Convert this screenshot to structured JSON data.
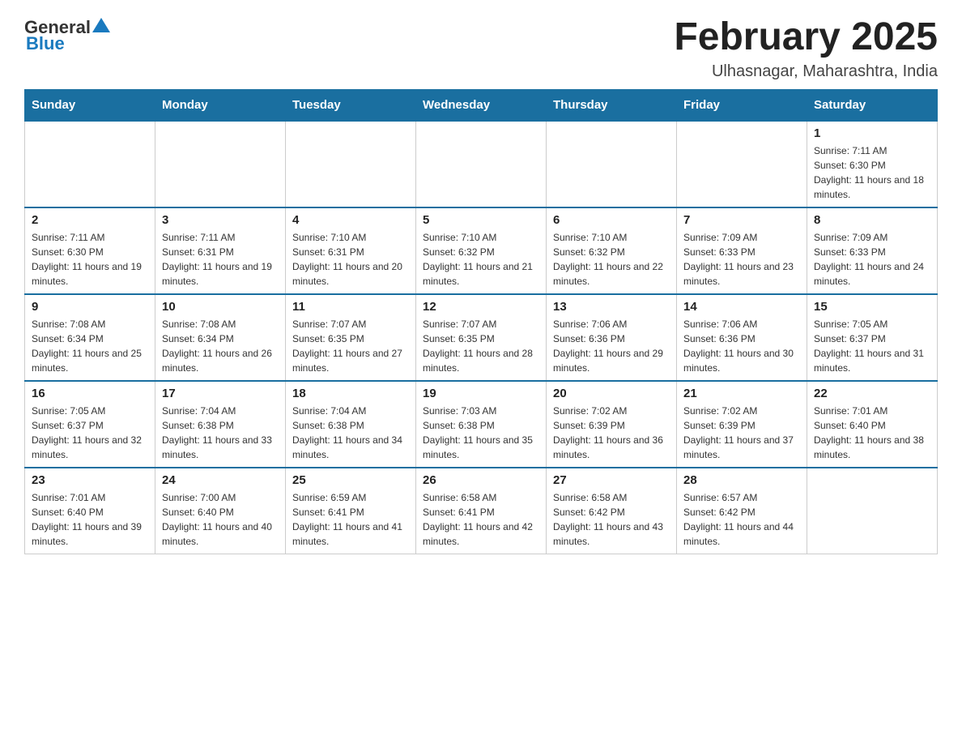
{
  "header": {
    "logo_general": "General",
    "logo_blue": "Blue",
    "month_title": "February 2025",
    "location": "Ulhasnagar, Maharashtra, India"
  },
  "weekdays": [
    "Sunday",
    "Monday",
    "Tuesday",
    "Wednesday",
    "Thursday",
    "Friday",
    "Saturday"
  ],
  "weeks": [
    [
      {
        "day": "",
        "sunrise": "",
        "sunset": "",
        "daylight": "",
        "empty": true
      },
      {
        "day": "",
        "sunrise": "",
        "sunset": "",
        "daylight": "",
        "empty": true
      },
      {
        "day": "",
        "sunrise": "",
        "sunset": "",
        "daylight": "",
        "empty": true
      },
      {
        "day": "",
        "sunrise": "",
        "sunset": "",
        "daylight": "",
        "empty": true
      },
      {
        "day": "",
        "sunrise": "",
        "sunset": "",
        "daylight": "",
        "empty": true
      },
      {
        "day": "",
        "sunrise": "",
        "sunset": "",
        "daylight": "",
        "empty": true
      },
      {
        "day": "1",
        "sunrise": "Sunrise: 7:11 AM",
        "sunset": "Sunset: 6:30 PM",
        "daylight": "Daylight: 11 hours and 18 minutes.",
        "empty": false
      }
    ],
    [
      {
        "day": "2",
        "sunrise": "Sunrise: 7:11 AM",
        "sunset": "Sunset: 6:30 PM",
        "daylight": "Daylight: 11 hours and 19 minutes.",
        "empty": false
      },
      {
        "day": "3",
        "sunrise": "Sunrise: 7:11 AM",
        "sunset": "Sunset: 6:31 PM",
        "daylight": "Daylight: 11 hours and 19 minutes.",
        "empty": false
      },
      {
        "day": "4",
        "sunrise": "Sunrise: 7:10 AM",
        "sunset": "Sunset: 6:31 PM",
        "daylight": "Daylight: 11 hours and 20 minutes.",
        "empty": false
      },
      {
        "day": "5",
        "sunrise": "Sunrise: 7:10 AM",
        "sunset": "Sunset: 6:32 PM",
        "daylight": "Daylight: 11 hours and 21 minutes.",
        "empty": false
      },
      {
        "day": "6",
        "sunrise": "Sunrise: 7:10 AM",
        "sunset": "Sunset: 6:32 PM",
        "daylight": "Daylight: 11 hours and 22 minutes.",
        "empty": false
      },
      {
        "day": "7",
        "sunrise": "Sunrise: 7:09 AM",
        "sunset": "Sunset: 6:33 PM",
        "daylight": "Daylight: 11 hours and 23 minutes.",
        "empty": false
      },
      {
        "day": "8",
        "sunrise": "Sunrise: 7:09 AM",
        "sunset": "Sunset: 6:33 PM",
        "daylight": "Daylight: 11 hours and 24 minutes.",
        "empty": false
      }
    ],
    [
      {
        "day": "9",
        "sunrise": "Sunrise: 7:08 AM",
        "sunset": "Sunset: 6:34 PM",
        "daylight": "Daylight: 11 hours and 25 minutes.",
        "empty": false
      },
      {
        "day": "10",
        "sunrise": "Sunrise: 7:08 AM",
        "sunset": "Sunset: 6:34 PM",
        "daylight": "Daylight: 11 hours and 26 minutes.",
        "empty": false
      },
      {
        "day": "11",
        "sunrise": "Sunrise: 7:07 AM",
        "sunset": "Sunset: 6:35 PM",
        "daylight": "Daylight: 11 hours and 27 minutes.",
        "empty": false
      },
      {
        "day": "12",
        "sunrise": "Sunrise: 7:07 AM",
        "sunset": "Sunset: 6:35 PM",
        "daylight": "Daylight: 11 hours and 28 minutes.",
        "empty": false
      },
      {
        "day": "13",
        "sunrise": "Sunrise: 7:06 AM",
        "sunset": "Sunset: 6:36 PM",
        "daylight": "Daylight: 11 hours and 29 minutes.",
        "empty": false
      },
      {
        "day": "14",
        "sunrise": "Sunrise: 7:06 AM",
        "sunset": "Sunset: 6:36 PM",
        "daylight": "Daylight: 11 hours and 30 minutes.",
        "empty": false
      },
      {
        "day": "15",
        "sunrise": "Sunrise: 7:05 AM",
        "sunset": "Sunset: 6:37 PM",
        "daylight": "Daylight: 11 hours and 31 minutes.",
        "empty": false
      }
    ],
    [
      {
        "day": "16",
        "sunrise": "Sunrise: 7:05 AM",
        "sunset": "Sunset: 6:37 PM",
        "daylight": "Daylight: 11 hours and 32 minutes.",
        "empty": false
      },
      {
        "day": "17",
        "sunrise": "Sunrise: 7:04 AM",
        "sunset": "Sunset: 6:38 PM",
        "daylight": "Daylight: 11 hours and 33 minutes.",
        "empty": false
      },
      {
        "day": "18",
        "sunrise": "Sunrise: 7:04 AM",
        "sunset": "Sunset: 6:38 PM",
        "daylight": "Daylight: 11 hours and 34 minutes.",
        "empty": false
      },
      {
        "day": "19",
        "sunrise": "Sunrise: 7:03 AM",
        "sunset": "Sunset: 6:38 PM",
        "daylight": "Daylight: 11 hours and 35 minutes.",
        "empty": false
      },
      {
        "day": "20",
        "sunrise": "Sunrise: 7:02 AM",
        "sunset": "Sunset: 6:39 PM",
        "daylight": "Daylight: 11 hours and 36 minutes.",
        "empty": false
      },
      {
        "day": "21",
        "sunrise": "Sunrise: 7:02 AM",
        "sunset": "Sunset: 6:39 PM",
        "daylight": "Daylight: 11 hours and 37 minutes.",
        "empty": false
      },
      {
        "day": "22",
        "sunrise": "Sunrise: 7:01 AM",
        "sunset": "Sunset: 6:40 PM",
        "daylight": "Daylight: 11 hours and 38 minutes.",
        "empty": false
      }
    ],
    [
      {
        "day": "23",
        "sunrise": "Sunrise: 7:01 AM",
        "sunset": "Sunset: 6:40 PM",
        "daylight": "Daylight: 11 hours and 39 minutes.",
        "empty": false
      },
      {
        "day": "24",
        "sunrise": "Sunrise: 7:00 AM",
        "sunset": "Sunset: 6:40 PM",
        "daylight": "Daylight: 11 hours and 40 minutes.",
        "empty": false
      },
      {
        "day": "25",
        "sunrise": "Sunrise: 6:59 AM",
        "sunset": "Sunset: 6:41 PM",
        "daylight": "Daylight: 11 hours and 41 minutes.",
        "empty": false
      },
      {
        "day": "26",
        "sunrise": "Sunrise: 6:58 AM",
        "sunset": "Sunset: 6:41 PM",
        "daylight": "Daylight: 11 hours and 42 minutes.",
        "empty": false
      },
      {
        "day": "27",
        "sunrise": "Sunrise: 6:58 AM",
        "sunset": "Sunset: 6:42 PM",
        "daylight": "Daylight: 11 hours and 43 minutes.",
        "empty": false
      },
      {
        "day": "28",
        "sunrise": "Sunrise: 6:57 AM",
        "sunset": "Sunset: 6:42 PM",
        "daylight": "Daylight: 11 hours and 44 minutes.",
        "empty": false
      },
      {
        "day": "",
        "sunrise": "",
        "sunset": "",
        "daylight": "",
        "empty": true
      }
    ]
  ]
}
